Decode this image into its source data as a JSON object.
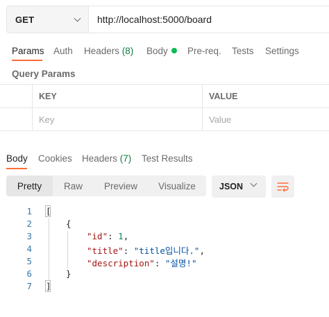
{
  "request": {
    "method": "GET",
    "url": "http://localhost:5000/board"
  },
  "request_tabs": [
    {
      "label": "Params",
      "active": true
    },
    {
      "label": "Auth"
    },
    {
      "label": "Headers",
      "count": "(8)"
    },
    {
      "label": "Body",
      "indicator": "green-dot"
    },
    {
      "label": "Pre-req."
    },
    {
      "label": "Tests"
    },
    {
      "label": "Settings"
    }
  ],
  "query_params": {
    "title": "Query Params",
    "headers": {
      "key": "KEY",
      "value": "VALUE"
    },
    "placeholders": {
      "key": "Key",
      "value": "Value"
    }
  },
  "response_tabs": [
    {
      "label": "Body",
      "active": true
    },
    {
      "label": "Cookies"
    },
    {
      "label": "Headers",
      "count": "(7)"
    },
    {
      "label": "Test Results"
    }
  ],
  "view_modes": [
    "Pretty",
    "Raw",
    "Preview",
    "Visualize"
  ],
  "active_view_mode": "Pretty",
  "format": "JSON",
  "code": {
    "line_numbers": [
      "1",
      "2",
      "3",
      "4",
      "5",
      "6",
      "7"
    ],
    "open_bracket": "[",
    "open_brace": "{",
    "id_key": "\"id\"",
    "id_value": "1",
    "title_key": "\"title\"",
    "title_value": "\"title입니다.\"",
    "description_key": "\"description\"",
    "description_value": "\"설명!\"",
    "colon": ": ",
    "comma": ",",
    "close_brace": "}",
    "close_bracket": "]"
  },
  "colors": {
    "accent": "#ff6c37",
    "count_green": "#0c7b3e",
    "dot_green": "#0cbb52",
    "json_key": "#a31515",
    "json_string": "#0451a5",
    "json_number": "#098658",
    "line_number": "#3b78a6"
  },
  "icons": {
    "method_dropdown": "chevron-down-icon",
    "format_dropdown": "chevron-down-icon",
    "wrap": "wrap-lines-icon"
  }
}
